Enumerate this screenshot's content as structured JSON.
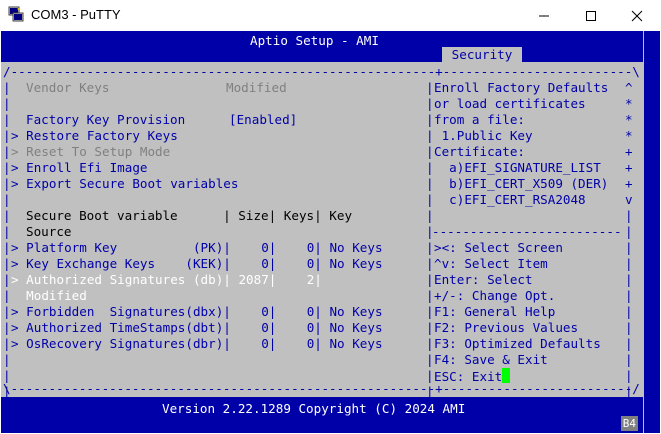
{
  "window": {
    "title": "COM3 - PuTTY"
  },
  "bios": {
    "header": "Aptio Setup - AMI",
    "active_tab": "Security",
    "footer": "Version 2.22.1289 Copyright (C) 2024 AMI",
    "badge": "B4"
  },
  "left": {
    "vendor_keys_label": "Vendor Keys",
    "vendor_keys_value": "Modified",
    "factory_key_label": "Factory Key Provision",
    "factory_key_value": "[Enabled]",
    "restore_factory": "> Restore Factory Keys",
    "reset_setup": "> Reset To Setup Mode",
    "enroll_efi": "> Enroll Efi Image",
    "export_secure": "> Export Secure Boot variables",
    "table_header": "Secure Boot variable      | Size| Keys| Key",
    "table_header2": "Source",
    "rows": [
      {
        "text": "> Platform Key          (PK)|    0|    0| No Keys",
        "style": "blue"
      },
      {
        "text": "> Key Exchange Keys    (KEK)|    0|    0| No Keys",
        "style": "blue"
      },
      {
        "text": "> Authorized Signatures (db)| 2087|    2|",
        "style": "white"
      },
      {
        "text": "  Modified",
        "style": "white"
      },
      {
        "text": "> Forbidden  Signatures(dbx)|    0|    0| No Keys",
        "style": "blue"
      },
      {
        "text": "> Authorized TimeStamps(dbt)|    0|    0| No Keys",
        "style": "blue"
      },
      {
        "text": "> OsRecovery Signatures(dbr)|    0|    0| No Keys",
        "style": "blue"
      }
    ]
  },
  "right": {
    "help": [
      "Enroll Factory Defaults",
      "or load certificates",
      "from a file:",
      " 1.Public Key",
      "Certificate:",
      "  a)EFI_SIGNATURE_LIST",
      "  b)EFI_CERT_X509 (DER)",
      "  c)EFI_CERT_RSA2048"
    ],
    "scroll_marks": [
      "^",
      "*",
      "*",
      "*",
      "+",
      "+",
      "+",
      "v"
    ],
    "divider": "-------------------------",
    "keys": [
      "><: Select Screen",
      "^v: Select Item",
      "Enter: Select",
      "+/-: Change Opt.",
      "F1: General Help",
      "F2: Previous Values",
      "F3: Optimized Defaults",
      "F4: Save & Exit",
      "ESC: Exit"
    ]
  }
}
